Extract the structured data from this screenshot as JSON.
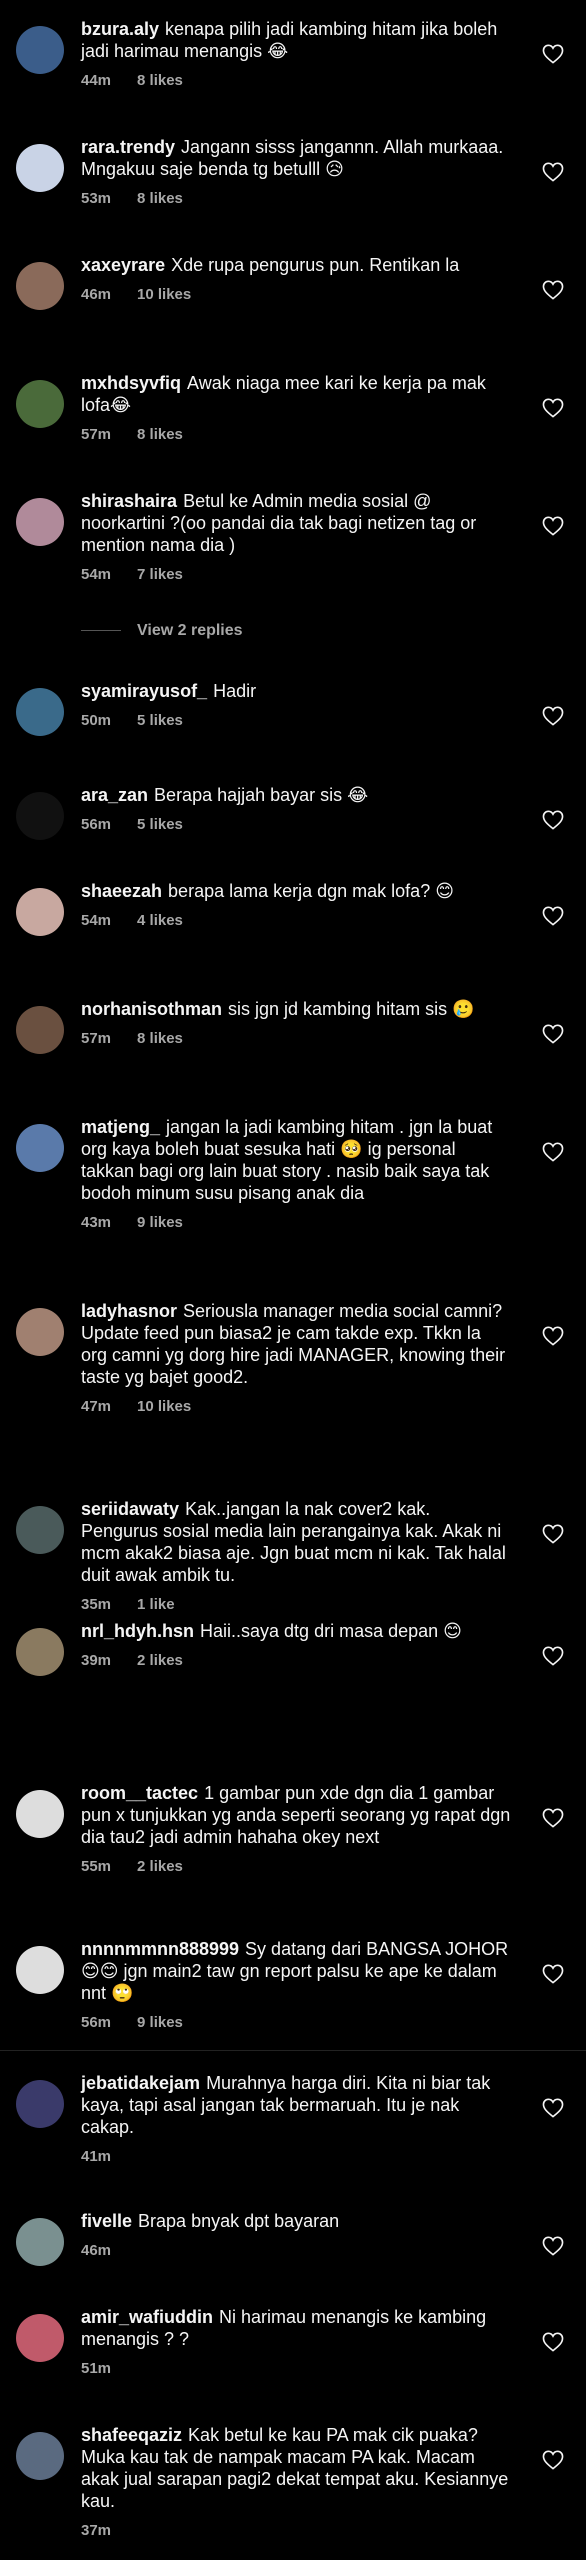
{
  "colors": {
    "background": "#000000",
    "text": "#f5f5f5",
    "muted": "#a8a8a8"
  },
  "comments": [
    {
      "user": "bzura.aly",
      "text": "kenapa pilih jadi kambing hitam jika boleh jadi harimau menangis 😂",
      "time": "44m",
      "likes": "8 likes",
      "avatar": "#3b5d8a"
    },
    {
      "user": "rara.trendy",
      "text": "Jangann sisss jangannn. Allah murkaaa. Mngakuu saje benda tg betulll 😥",
      "time": "53m",
      "likes": "8 likes",
      "avatar": "#c9d3e6"
    },
    {
      "user": "xaxeyrare",
      "text": "Xde rupa pengurus pun. Rentikan la",
      "time": "46m",
      "likes": "10 likes",
      "avatar": "#8a6a5a"
    },
    {
      "user": "mxhdsyvfiq",
      "text": "Awak niaga mee kari ke kerja pa mak lofa😂",
      "time": "57m",
      "likes": "8 likes",
      "avatar": "#4a6a3a"
    },
    {
      "user": "shirashaira",
      "text": "Betul ke Admin media sosial @ noorkartini ?(oo pandai dia tak bagi netizen tag or mention nama dia )",
      "time": "54m",
      "likes": "7 likes",
      "avatar": "#b08a9a"
    },
    {
      "user": "syamirayusof_",
      "text": "Hadir",
      "time": "50m",
      "likes": "5 likes",
      "avatar": "#3a6a8a"
    },
    {
      "user": "ara_zan",
      "text": "Berapa hajjah bayar sis 😂",
      "time": "56m",
      "likes": "5 likes",
      "avatar": "#111111"
    },
    {
      "user": "shaeezah",
      "text": "berapa lama kerja dgn mak lofa? 😊",
      "time": "54m",
      "likes": "4 likes",
      "avatar": "#c8a8a0"
    },
    {
      "user": "norhanisothman",
      "text": "sis jgn jd kambing hitam sis 🥲",
      "time": "57m",
      "likes": "8 likes",
      "avatar": "#6a5040"
    },
    {
      "user": "matjeng_",
      "text": "jangan la jadi kambing hitam . jgn la buat org kaya  boleh buat sesuka hati 🥺 ig personal takkan bagi org lain buat story . nasib baik saya tak bodoh minum susu pisang anak dia",
      "time": "43m",
      "likes": "9 likes",
      "avatar": "#5a7aaa"
    },
    {
      "user": "ladyhasnor",
      "text": "Seriousla manager media social camni? Update feed pun biasa2 je cam takde exp. Tkkn la org camni yg dorg hire jadi MANAGER, knowing their taste yg bajet good2.",
      "time": "47m",
      "likes": "10 likes",
      "avatar": "#a08070"
    },
    {
      "user": "seriidawaty",
      "text": "Kak..jangan la nak cover2 kak. Pengurus sosial media lain perangainya kak. Akak ni mcm akak2 biasa aje. Jgn buat mcm ni kak. Tak halal duit awak ambik tu.",
      "time": "35m",
      "likes": "1 like",
      "avatar": "#4a5a5a"
    },
    {
      "user": "nrl_hdyh.hsn",
      "text": "Haii..saya dtg dri masa depan 😊",
      "time": "39m",
      "likes": "2 likes",
      "avatar": "#8a7a60"
    },
    {
      "user": "room__tactec",
      "text": "1 gambar pun xde dgn dia 1 gambar pun x tunjukkan yg anda seperti seorang yg rapat dgn dia tau2 jadi admin hahaha okey next",
      "time": "55m",
      "likes": "2 likes",
      "avatar": "#dddddd"
    },
    {
      "user": "nnnnmmnn888999",
      "text": "Sy datang dari BANGSA JOHOR 😊😊 jgn main2 taw gn report palsu ke ape ke dalam nnt 🙄",
      "time": "56m",
      "likes": "9 likes",
      "avatar": "#dddddd"
    },
    {
      "user": "jebatidakejam",
      "text": "Murahnya harga diri. Kita ni biar tak kaya, tapi asal jangan tak bermaruah. Itu je nak cakap.",
      "time": "41m",
      "likes": "",
      "avatar": "#3a3a6a"
    },
    {
      "user": "fivelle",
      "text": "Brapa bnyak dpt bayaran",
      "time": "46m",
      "likes": "",
      "avatar": "#7a9090"
    },
    {
      "user": "amir_wafiuddin",
      "text": "Ni harimau menangis ke kambing menangis ? ?",
      "time": "51m",
      "likes": "",
      "avatar": "#c05a6a"
    },
    {
      "user": "shafeeqaziz",
      "text": "Kak betul ke kau PA mak cik puaka? Muka kau tak de nampak macam PA kak. Macam akak jual sarapan pagi2 dekat tempat aku. Kesiannye kau.",
      "time": "37m",
      "likes": "",
      "avatar": "#5a6a80"
    }
  ],
  "view_replies": "View 2 replies"
}
